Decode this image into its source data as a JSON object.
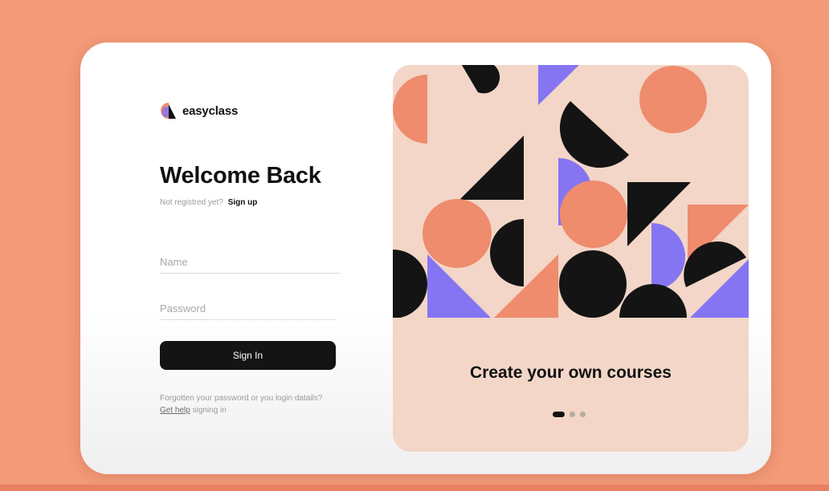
{
  "brand": {
    "name": "easyclass",
    "logo_icon": "easyclass-logo-icon"
  },
  "login": {
    "title": "Welcome Back",
    "signup_prompt": "Not registred yet?",
    "signup_link": "Sign up",
    "name_placeholder": "Name",
    "password_placeholder": "Password",
    "signin_label": "Sign In",
    "help_line1": "Forgotten your password or you login datails?",
    "help_link": "Get help",
    "help_line2_rest": " signing in"
  },
  "carousel": {
    "caption": "Create your own courses",
    "total_slides": 3,
    "active_slide": 1
  },
  "colors": {
    "background": "#f39a78",
    "accent_orange": "#ee8c6d",
    "accent_purple": "#8575f3",
    "panel": "#f3d6c7",
    "dark": "#141414"
  }
}
